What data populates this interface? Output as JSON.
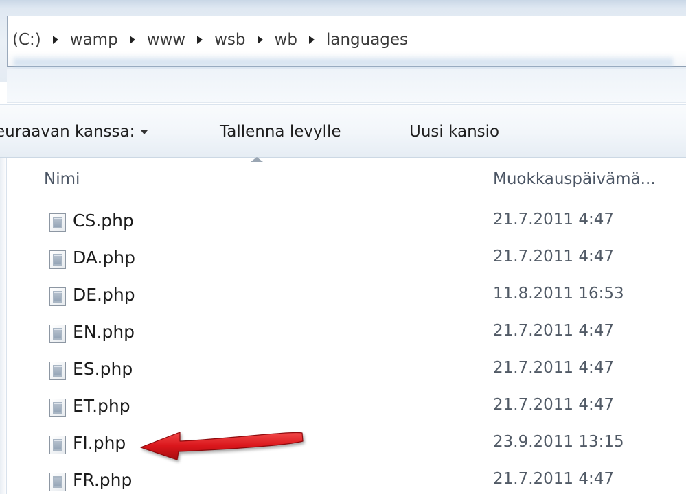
{
  "address_bar": {
    "crumbs": [
      "(C:)",
      "wamp",
      "www",
      "wsb",
      "wb",
      "languages"
    ]
  },
  "command_bar": {
    "share_label": "euraavan kanssa:",
    "burn_label": "Tallenna levylle",
    "new_folder_label": "Uusi kansio"
  },
  "file_list": {
    "columns": {
      "name": "Nimi",
      "date_modified": "Muokkauspäivämä..."
    },
    "rows": [
      {
        "name": "CS.php",
        "date": "21.7.2011 4:47"
      },
      {
        "name": "DA.php",
        "date": "21.7.2011 4:47"
      },
      {
        "name": "DE.php",
        "date": "11.8.2011 16:53"
      },
      {
        "name": "EN.php",
        "date": "21.7.2011 4:47"
      },
      {
        "name": "ES.php",
        "date": "21.7.2011 4:47"
      },
      {
        "name": "ET.php",
        "date": "21.7.2011 4:47"
      },
      {
        "name": "FI.php",
        "date": "23.9.2011 13:15"
      },
      {
        "name": "FR.php",
        "date": "21.7.2011 4:47"
      }
    ]
  },
  "icons": {
    "file": "php-file-icon",
    "breadcrumb_separator": "chevron-right-icon",
    "sort": "sort-ascending-icon",
    "annotation": "red-arrow-annotation"
  },
  "colors": {
    "annotation_red": "#d9161b",
    "header_text": "#4b5564",
    "date_text": "#515a66"
  }
}
